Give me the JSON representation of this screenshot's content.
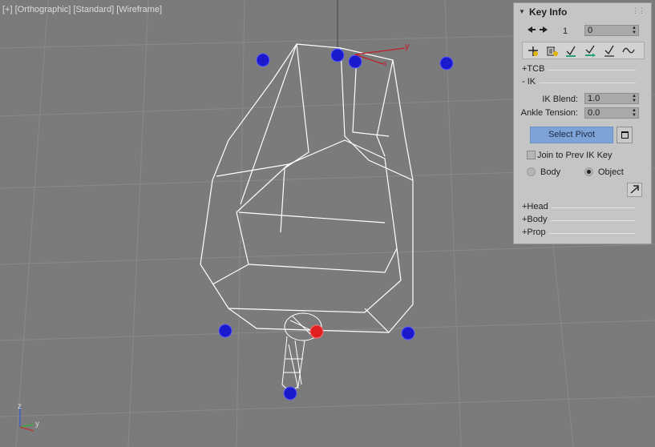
{
  "viewport": {
    "label_plus": "[+]",
    "label_view": "[Orthographic]",
    "label_shading": "[Standard]",
    "label_mode": "[Wireframe]",
    "axis_y": "y",
    "axis_x": "x",
    "triad_z": "z",
    "triad_y": "y"
  },
  "key_info": {
    "title": "Key Info",
    "collapse_glyph": "▼",
    "prev_key_glyph": "✚",
    "key_number": "1",
    "time_value": "0",
    "sections": {
      "tcb": "+TCB",
      "ik": "- IK",
      "head": "+Head",
      "body": "+Body",
      "prop": "+Prop"
    },
    "ik_blend_label": "IK Blend:",
    "ik_blend_value": "1.0",
    "ankle_tension_label": "Ankle Tension:",
    "ankle_tension_value": "0.0",
    "select_pivot_label": "Select Pivot",
    "join_prev_label": "Join to Prev IK Key",
    "join_prev_checked": false,
    "space_body_label": "Body",
    "space_object_label": "Object",
    "space_selected": "Object"
  },
  "colors": {
    "viewport_bg": "#7b7b7b",
    "panel_bg": "#c5c5c5",
    "pivot_blue": "#1a1acc",
    "pivot_red": "#e02020",
    "wire": "#ffffff",
    "accent_button": "#7ea3d6"
  }
}
